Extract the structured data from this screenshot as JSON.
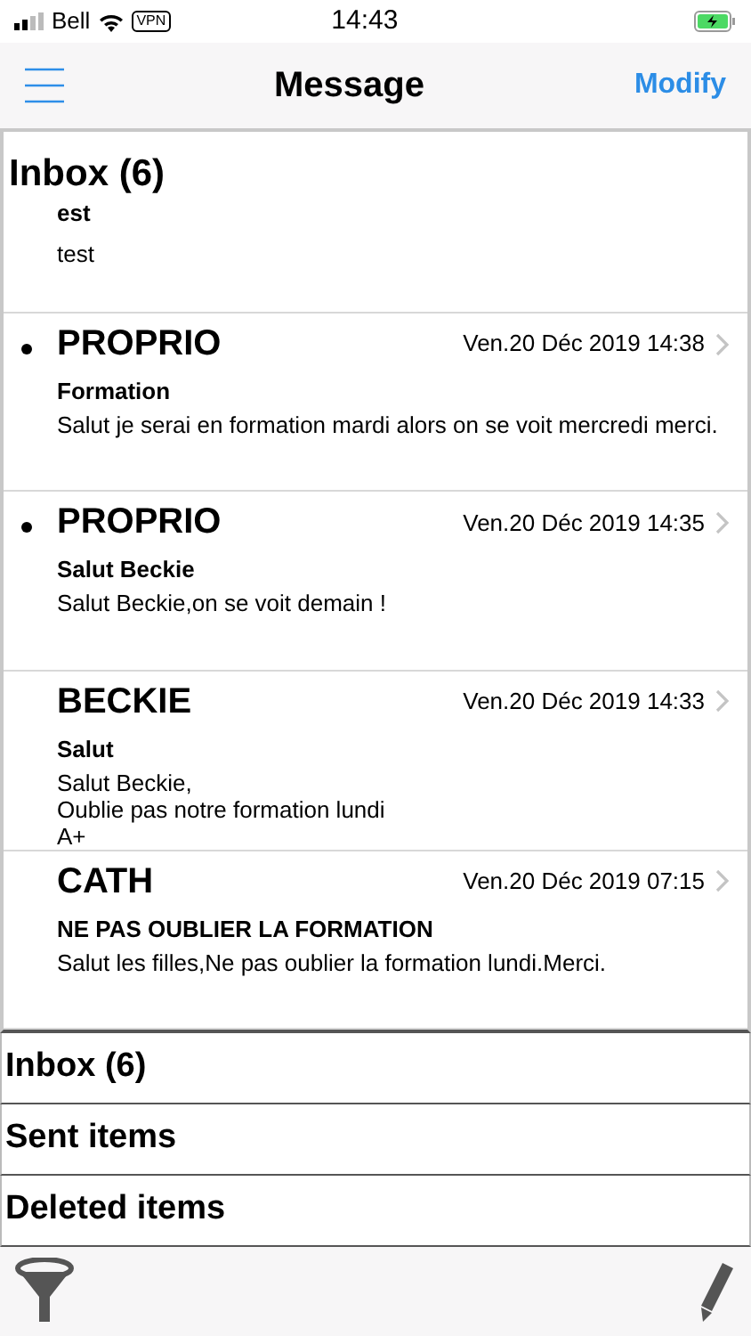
{
  "status_bar": {
    "carrier": "Bell",
    "vpn": "VPN",
    "time": "14:43"
  },
  "nav": {
    "title": "Message",
    "action": "Modify"
  },
  "inbox": {
    "title": "Inbox (6)",
    "partial": {
      "subject": "est",
      "body": [
        "test"
      ]
    },
    "messages": [
      {
        "sender": "PROPRIO",
        "date": "Ven.20 Déc 2019 14:38",
        "subject": "Formation",
        "body": [
          "Salut je serai en formation mardi alors on se voit mercredi merci."
        ],
        "unread": true
      },
      {
        "sender": "PROPRIO",
        "date": "Ven.20 Déc 2019 14:35",
        "subject": "Salut Beckie",
        "body": [
          "Salut Beckie,on se voit demain !"
        ],
        "unread": true
      },
      {
        "sender": "BECKIE",
        "date": "Ven.20 Déc 2019 14:33",
        "subject": "Salut",
        "body": [
          "Salut Beckie,",
          "Oublie pas notre formation lundi",
          "A+"
        ],
        "unread": false
      },
      {
        "sender": "CATH",
        "date": "Ven.20 Déc 2019 07:15",
        "subject": "NE PAS OUBLIER LA FORMATION",
        "body": [
          "Salut les filles,Ne pas oublier la formation lundi.Merci."
        ],
        "unread": false
      }
    ]
  },
  "folders": [
    "Inbox (6)",
    "Sent items",
    "Deleted items"
  ]
}
